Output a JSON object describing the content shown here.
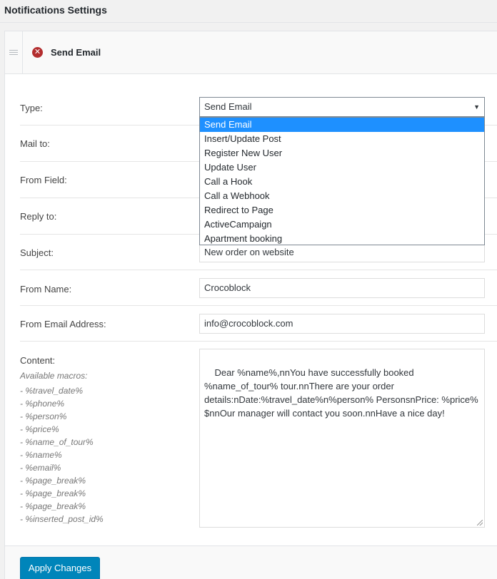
{
  "page": {
    "title": "Notifications Settings"
  },
  "notification": {
    "title": "Send Email"
  },
  "form": {
    "type": {
      "label": "Type:",
      "value": "Send Email"
    },
    "type_options": [
      "Send Email",
      "Insert/Update Post",
      "Register New User",
      "Update User",
      "Call a Hook",
      "Call a Webhook",
      "Redirect to Page",
      "ActiveCampaign",
      "Apartment booking"
    ],
    "mail_to": {
      "label": "Mail to:"
    },
    "from_field": {
      "label": "From Field:"
    },
    "reply_to": {
      "label": "Reply to:"
    },
    "subject": {
      "label": "Subject:",
      "value": "New order on website"
    },
    "from_name": {
      "label": "From Name:",
      "value": "Crocoblock"
    },
    "from_email": {
      "label": "From Email Address:",
      "value": "info@crocoblock.com"
    },
    "content": {
      "label": "Content:",
      "value": "Dear %name%,nnYou have successfully booked %name_of_tour% tour.nnThere are your order details:nDate:%travel_date%n%person% PersonsnPrice: %price% $nnOur manager will contact you soon.nnHave a nice day!"
    },
    "macros": {
      "title": "Available macros:",
      "items": [
        "- %travel_date%",
        "- %phone%",
        "- %person%",
        "- %price%",
        "- %name_of_tour%",
        "- %name%",
        "- %email%",
        "- %page_break%",
        "- %page_break%",
        "- %page_break%",
        "- %inserted_post_id%"
      ]
    }
  },
  "footer": {
    "apply_label": "Apply Changes"
  },
  "colors": {
    "accent": "#0085ba",
    "selected_option": "#1e90ff",
    "delete": "#b32d2e"
  }
}
